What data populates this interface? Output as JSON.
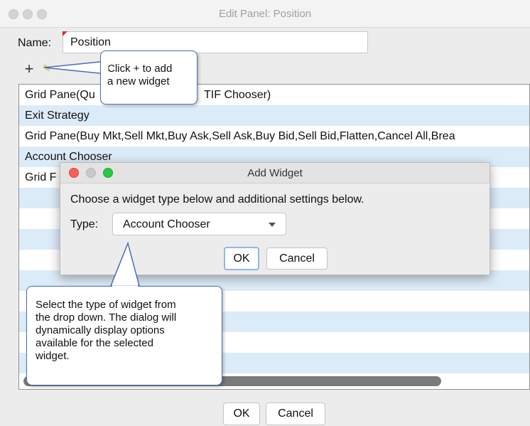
{
  "window": {
    "title": "Edit Panel: Position"
  },
  "name_field": {
    "label": "Name:",
    "value": "Position"
  },
  "toolbar": {
    "add_icon": "plus-icon",
    "edit_icon": "pencil-icon",
    "remove_icon": "x-icon"
  },
  "list": {
    "rows": [
      "Grid Pane(Qu",
      "Exit Strategy",
      "Grid Pane(Buy Mkt,Sell Mkt,Buy Ask,Sell Ask,Buy Bid,Sell Bid,Flatten,Cancel All,Brea",
      "Account Chooser",
      "Grid F"
    ],
    "row0_tail": "TIF Chooser)"
  },
  "buttons": {
    "ok": "OK",
    "cancel": "Cancel"
  },
  "dialog": {
    "title": "Add Widget",
    "message": "Choose a widget type below and additional settings below.",
    "type_label": "Type:",
    "type_value": "Account Chooser",
    "ok": "OK",
    "cancel": "Cancel"
  },
  "callouts": {
    "add_hint": [
      "Click + to add",
      "a new widget"
    ],
    "type_hint": [
      "Select the type of widget from",
      "the drop down.  The dialog will",
      "dynamically  display options",
      "available for the selected",
      "widget."
    ]
  },
  "colors": {
    "row_alt": "#dcebf8",
    "callout_border": "#4a6fb5",
    "close": "#fc5f57",
    "minimize": "#c8c8c8",
    "zoom": "#28c840"
  }
}
